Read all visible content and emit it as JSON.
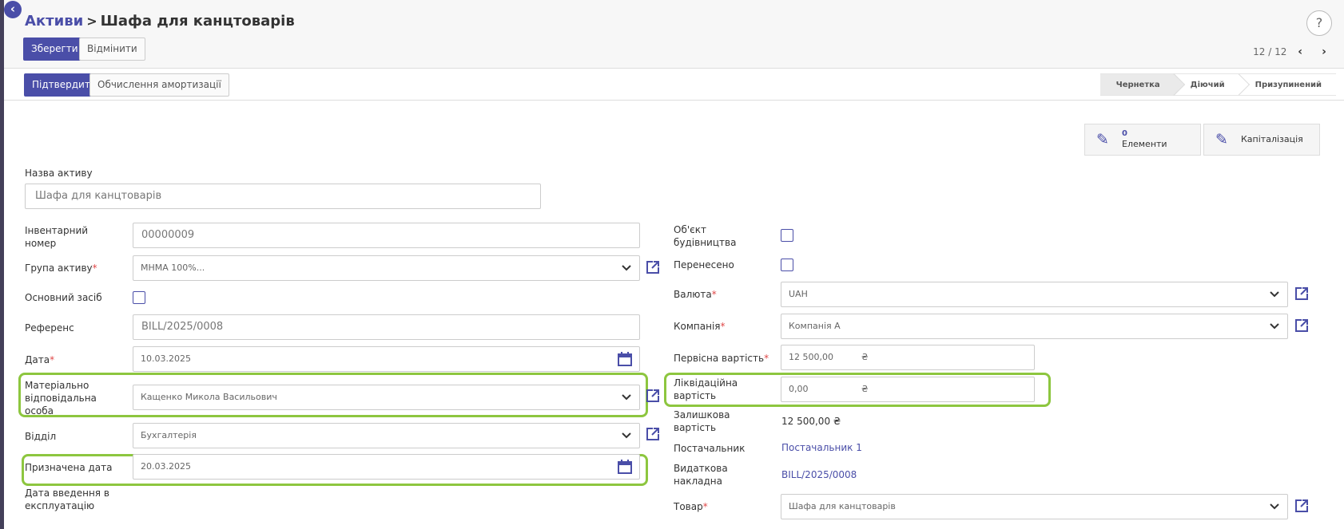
{
  "breadcrumb": {
    "parent": "Активи",
    "current": "Шафа для канцтоварів"
  },
  "help_icon": "?",
  "toolbar": {
    "save": "Зберегти",
    "discard": "Відмінити"
  },
  "pager": {
    "value": "12 / 12"
  },
  "actions": {
    "confirm": "Підтвердити",
    "compute_depreciation": "Обчислення амортизації"
  },
  "stages": [
    "Чернетка",
    "Діючий",
    "Призупинений"
  ],
  "active_stage": "Чернетка",
  "smart_buttons": {
    "elements_count": "0",
    "elements_label": "Елементи",
    "capitalization_label": "Капіталізація"
  },
  "asset_name": {
    "label": "Назва активу",
    "placeholder": "Шафа для канцтоварів"
  },
  "left": {
    "inventory_number": {
      "label": "Інвентарний номер",
      "value": "00000009"
    },
    "asset_group": {
      "label": "Група активу",
      "value": "МНМА 100%..."
    },
    "fixed_asset": {
      "label": "Основний засіб"
    },
    "reference": {
      "label": "Референс",
      "value": "BILL/2025/0008"
    },
    "date": {
      "label": "Дата",
      "value": "10.03.2025"
    },
    "responsible_person": {
      "label": "Матеріально відповідальна особа",
      "value": "Кащенко Микола Васильович"
    },
    "department": {
      "label": "Відділ",
      "value": "Бухгалтерія"
    },
    "assigned_date": {
      "label": "Призначена дата",
      "value": "20.03.2025"
    },
    "commissioning_date": {
      "label": "Дата введення в експлуатацію"
    }
  },
  "right": {
    "construction_object": {
      "label": "Об'єкт будівництва"
    },
    "transferred": {
      "label": "Перенесено"
    },
    "currency": {
      "label": "Валюта",
      "value": "UAH"
    },
    "company": {
      "label": "Компанія",
      "value": "Компанія А"
    },
    "original_value": {
      "label": "Первісна вартість",
      "value": "12 500,00",
      "symbol": "₴"
    },
    "salvage_value": {
      "label": "Ліквідаційна вартість",
      "value": "0,00",
      "symbol": "₴"
    },
    "residual_value": {
      "label": "Залишкова вартість",
      "value": "12 500,00 ₴"
    },
    "vendor": {
      "label": "Постачальник",
      "value": "Постачальник 1"
    },
    "vendor_bill": {
      "label": "Видаткова накладна",
      "value": "BILL/2025/0008"
    },
    "product": {
      "label": "Товар",
      "value": "Шафа для канцтоварів"
    }
  },
  "colors": {
    "accent": "#4a4ea8",
    "highlight": "#8dc63f",
    "required": "#e04848"
  }
}
